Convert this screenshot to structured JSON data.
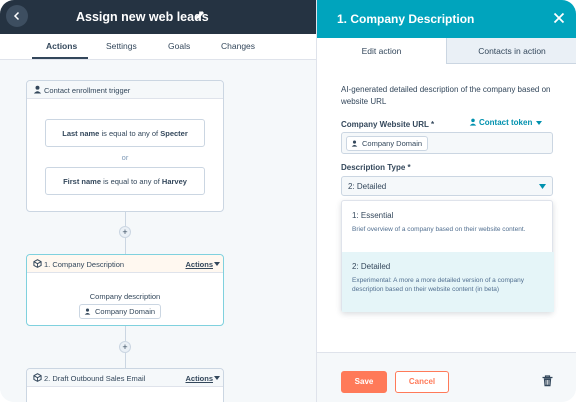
{
  "workflow": {
    "title": "Assign new web leads",
    "tabs": [
      "Actions",
      "Settings",
      "Goals",
      "Changes"
    ],
    "active_tab": "Actions"
  },
  "canvas": {
    "trigger": {
      "label": "Contact enrollment trigger",
      "conditions": [
        {
          "field": "Last name",
          "op": "is equal to any of",
          "value": "Specter"
        },
        {
          "field": "First name",
          "op": "is equal to any of",
          "value": "Harvey"
        }
      ],
      "or_label": "or"
    },
    "step1": {
      "label": "1. Company Description",
      "actions_label": "Actions",
      "sub_label": "Company description",
      "token": "Company Domain"
    },
    "step2": {
      "label": "2. Draft Outbound Sales Email",
      "actions_label": "Actions"
    }
  },
  "panel": {
    "title": "1. Company Description",
    "tabs": [
      "Edit action",
      "Contacts in action"
    ],
    "active_tab": "Edit action",
    "description": "AI-generated detailed description of the company based on website URL",
    "url_field": {
      "label": "Company Website URL *",
      "contact_token_label": "Contact token",
      "token": "Company Domain"
    },
    "type_field": {
      "label": "Description Type *",
      "selected": "2: Detailed",
      "options": [
        {
          "label": "1: Essential",
          "description": "Brief overview of a company based on their website content."
        },
        {
          "label": "2: Detailed",
          "description": "Experimental: A more a more detailed version of a company description based on their website content (in beta)"
        }
      ]
    },
    "save_label": "Save",
    "cancel_label": "Cancel"
  },
  "colors": {
    "panel_header": "#00a4bd",
    "topbar": "#253342",
    "primary_button": "#ff7a59",
    "link": "#0091ae",
    "highlight_option": "#e5f5f8",
    "selected_card_border": "#7fd1de"
  },
  "icons": [
    "back-arrow-icon",
    "pencil-icon",
    "person-icon",
    "cube-icon",
    "caret-down-icon",
    "close-icon",
    "trash-icon",
    "plus-icon"
  ]
}
